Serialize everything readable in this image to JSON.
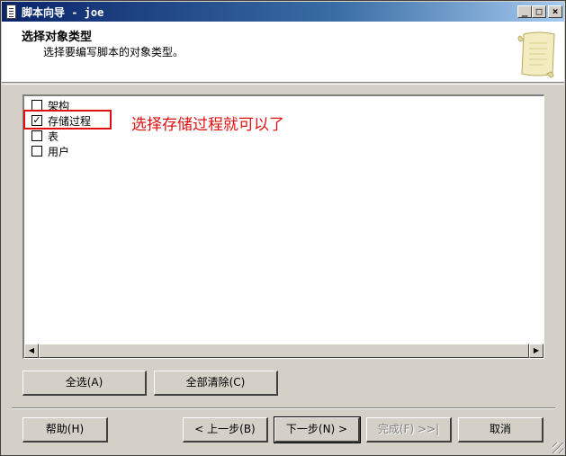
{
  "window": {
    "title": "脚本向导 - joe",
    "minimize": "_",
    "maximize": "□",
    "close": "×"
  },
  "header": {
    "title": "选择对象类型",
    "subtitle": "选择要编写脚本的对象类型。"
  },
  "object_types": [
    {
      "label": "架构",
      "checked": false,
      "mark": ""
    },
    {
      "label": "存储过程",
      "checked": true,
      "mark": "✓"
    },
    {
      "label": "表",
      "checked": false,
      "mark": ""
    },
    {
      "label": "用户",
      "checked": false,
      "mark": ""
    }
  ],
  "annotation": {
    "text": "选择存储过程就可以了",
    "color": "#e01010"
  },
  "scrollbar": {
    "left_arrow": "◀",
    "right_arrow": "▶"
  },
  "selection_buttons": {
    "select_all": "全选(A)",
    "clear_all": "全部清除(C)"
  },
  "nav_buttons": {
    "help": "帮助(H)",
    "back": "< 上一步(B)",
    "next": "下一步(N) >",
    "finish": "完成(F) >>|",
    "cancel": "取消"
  }
}
